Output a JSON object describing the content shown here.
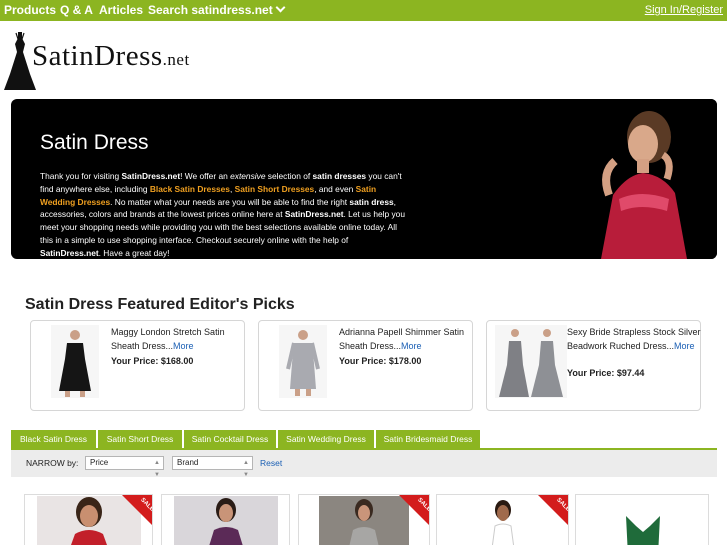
{
  "nav": {
    "items": [
      "Products",
      "Q & A",
      "Articles",
      "Search satindress.net"
    ],
    "signin": "Sign In/Register"
  },
  "logo": {
    "main": "SatinDress",
    "suffix": ".net"
  },
  "hero": {
    "title": "Satin Dress",
    "p1": "Thank you for visiting ",
    "site1": "SatinDress.net",
    "p2": "! We offer an ",
    "extensive": "extensive",
    "p3": " selection of ",
    "satin_dresses": "satin dresses",
    "p4": " you can't find anywhere else, including ",
    "link1": "Black Satin Dresses",
    "sep": ", ",
    "link2": "Satin Short Dresses",
    "p5": ", and even ",
    "link3": "Satin Wedding Dresses",
    "p6": ". No matter what your needs are you will be able to find the right ",
    "satin_dress": "satin dress",
    "p7": ", accessories, colors and brands at the lowest prices online here at ",
    "site2": "SatinDress.net",
    "p8": ". Let us help you meet your shopping needs while providing you with the best selections available online today. All this in a simple to use shopping interface. Checkout securely online with the help of ",
    "site3": "SatinDress.net",
    "p9": ". Have a great day!"
  },
  "featured": {
    "title": "Satin Dress Featured Editor's Picks",
    "more_label": "More",
    "price_label": "Your Price:",
    "items": [
      {
        "name": "Maggy London Stretch Satin Sheath Dress...",
        "price": "$168.00"
      },
      {
        "name": "Adrianna Papell Shimmer Satin Sheath Dress...",
        "price": "$178.00"
      },
      {
        "name": "Sexy Bride Strapless Stock Silver Beadwork Ruched Dress...",
        "price": "$97.44"
      }
    ]
  },
  "tabs": [
    "Black Satin Dress",
    "Satin Short Dress",
    "Satin Cocktail Dress",
    "Satin Wedding Dress",
    "Satin Bridesmaid Dress"
  ],
  "narrow": {
    "label": "NARROW by:",
    "price_option": "Price",
    "brand_option": "Brand",
    "reset": "Reset"
  },
  "sale_badge": "SALE",
  "colors": {
    "brand_green": "#8cb521",
    "accent_orange": "#f0a020",
    "sale_red": "#d31c1c",
    "link_blue": "#1a5fb4"
  }
}
